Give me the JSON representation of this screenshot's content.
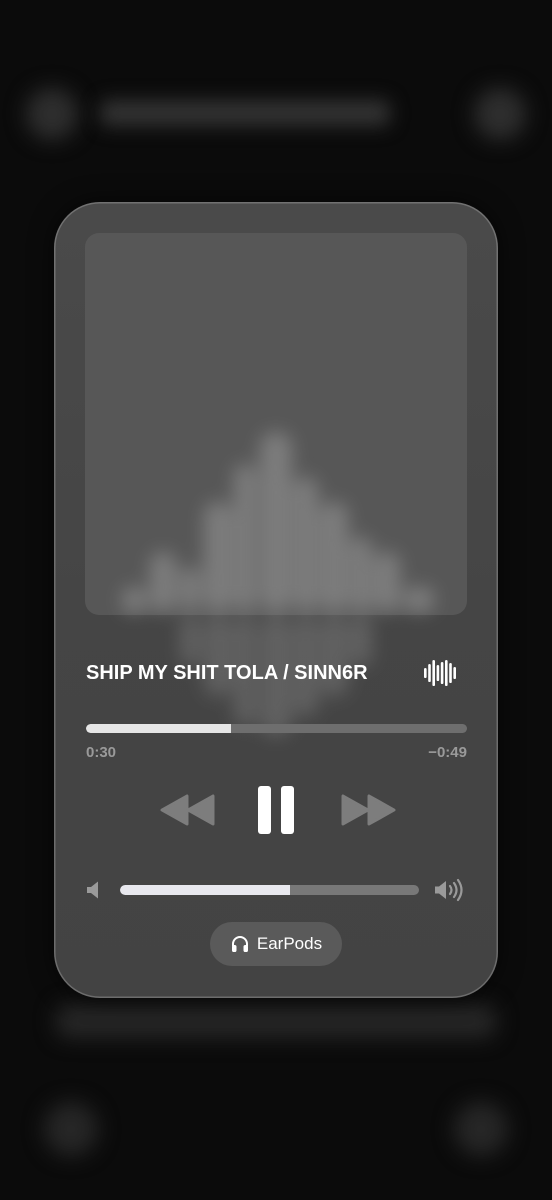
{
  "background": {
    "header_title": "SHIP MY SHIT TOLA / SINN6R"
  },
  "now_playing": {
    "track_title": "SHIP MY SHIT TOLA / SINN6R",
    "elapsed": "0:30",
    "remaining": "−0:49",
    "progress_fraction": 0.38,
    "volume_fraction": 0.57,
    "is_playing": true
  },
  "controls": {
    "rewind_icon": "rewind-icon",
    "pause_icon": "pause-icon",
    "forward_icon": "fast-forward-icon",
    "volume_low_icon": "speaker-low-icon",
    "volume_high_icon": "speaker-high-icon",
    "live_waveform_icon": "waveform-icon"
  },
  "output_device": {
    "label": "EarPods",
    "icon": "headphones-icon"
  },
  "colors": {
    "background": "#0b0b0b",
    "card": "#474747",
    "accent": "#ffffff",
    "muted_text": "#9a9a9a"
  }
}
